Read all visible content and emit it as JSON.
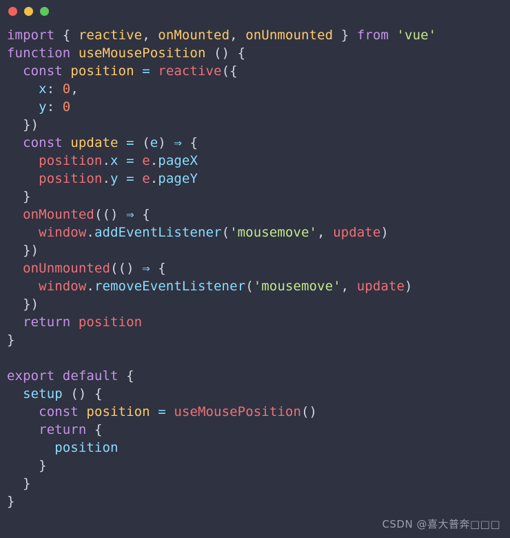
{
  "window": {
    "title_bar": {
      "buttons": [
        {
          "name": "close",
          "label": "",
          "color": "#f0635b"
        },
        {
          "name": "minimize",
          "label": "",
          "color": "#f0c04b"
        },
        {
          "name": "maximize",
          "label": "",
          "color": "#5bc85b"
        }
      ]
    },
    "background_color": "#2f3240"
  },
  "watermark": {
    "text": "CSDN @喜大普奔□□□"
  },
  "editor": {
    "language": "javascript",
    "font_size_px": 19,
    "line_height_px": 26,
    "theme": {
      "background": "#2f3240",
      "keyword": "#c792ea",
      "function": "#ffcb6b",
      "variable": "#f07178",
      "property": "#89ddff",
      "string": "#c3e88d",
      "number": "#f78c6c",
      "punctuation": "#d5d8e0",
      "operator": "#89ddff"
    },
    "code_text": "import { reactive, onMounted, onUnmounted } from 'vue'\nfunction useMousePosition () {\n  const position = reactive({\n    x: 0,\n    y: 0\n  })\n  const update = (e) => {\n    position.x = e.pageX\n    position.y = e.pageY\n  }\n  onMounted(() => {\n    window.addEventListener('mousemove', update)\n  })\n  onUnmounted(() => {\n    window.removeEventListener('mousemove', update)\n  })\n  return position\n}\n\nexport default {\n  setup () {\n    const position = useMousePosition()\n    return {\n      position\n    }\n  }\n}",
    "lines": [
      {
        "n": 1,
        "tokens": [
          {
            "t": "import",
            "c": "kw"
          },
          {
            "t": " ",
            "c": "plain"
          },
          {
            "t": "{",
            "c": "punc"
          },
          {
            "t": " ",
            "c": "plain"
          },
          {
            "t": "reactive",
            "c": "fn"
          },
          {
            "t": ",",
            "c": "punc"
          },
          {
            "t": " ",
            "c": "plain"
          },
          {
            "t": "onMounted",
            "c": "fn"
          },
          {
            "t": ",",
            "c": "punc"
          },
          {
            "t": " ",
            "c": "plain"
          },
          {
            "t": "onUnmounted",
            "c": "fn"
          },
          {
            "t": " ",
            "c": "plain"
          },
          {
            "t": "}",
            "c": "punc"
          },
          {
            "t": " ",
            "c": "plain"
          },
          {
            "t": "from",
            "c": "kw"
          },
          {
            "t": " ",
            "c": "plain"
          },
          {
            "t": "'vue'",
            "c": "str"
          }
        ]
      },
      {
        "n": 2,
        "tokens": [
          {
            "t": "function",
            "c": "kw"
          },
          {
            "t": " ",
            "c": "plain"
          },
          {
            "t": "useMousePosition",
            "c": "fn"
          },
          {
            "t": " ",
            "c": "plain"
          },
          {
            "t": "()",
            "c": "punc"
          },
          {
            "t": " ",
            "c": "plain"
          },
          {
            "t": "{",
            "c": "punc"
          }
        ]
      },
      {
        "n": 3,
        "tokens": [
          {
            "t": "  ",
            "c": "plain"
          },
          {
            "t": "const",
            "c": "kw"
          },
          {
            "t": " ",
            "c": "plain"
          },
          {
            "t": "position",
            "c": "fn"
          },
          {
            "t": " ",
            "c": "plain"
          },
          {
            "t": "=",
            "c": "op"
          },
          {
            "t": " ",
            "c": "plain"
          },
          {
            "t": "reactive",
            "c": "var"
          },
          {
            "t": "(",
            "c": "punc"
          },
          {
            "t": "{",
            "c": "punc"
          }
        ]
      },
      {
        "n": 4,
        "tokens": [
          {
            "t": "    ",
            "c": "plain"
          },
          {
            "t": "x",
            "c": "prop"
          },
          {
            "t": ":",
            "c": "punc"
          },
          {
            "t": " ",
            "c": "plain"
          },
          {
            "t": "0",
            "c": "num"
          },
          {
            "t": ",",
            "c": "punc"
          }
        ]
      },
      {
        "n": 5,
        "tokens": [
          {
            "t": "    ",
            "c": "plain"
          },
          {
            "t": "y",
            "c": "prop"
          },
          {
            "t": ":",
            "c": "punc"
          },
          {
            "t": " ",
            "c": "plain"
          },
          {
            "t": "0",
            "c": "num"
          }
        ]
      },
      {
        "n": 6,
        "tokens": [
          {
            "t": "  ",
            "c": "plain"
          },
          {
            "t": "})",
            "c": "punc"
          }
        ]
      },
      {
        "n": 7,
        "tokens": [
          {
            "t": "  ",
            "c": "plain"
          },
          {
            "t": "const",
            "c": "kw"
          },
          {
            "t": " ",
            "c": "plain"
          },
          {
            "t": "update",
            "c": "fn"
          },
          {
            "t": " ",
            "c": "plain"
          },
          {
            "t": "=",
            "c": "op"
          },
          {
            "t": " ",
            "c": "plain"
          },
          {
            "t": "(",
            "c": "punc"
          },
          {
            "t": "e",
            "c": "prop"
          },
          {
            "t": ")",
            "c": "punc"
          },
          {
            "t": " ",
            "c": "plain"
          },
          {
            "t": "⇒",
            "c": "op"
          },
          {
            "t": " ",
            "c": "plain"
          },
          {
            "t": "{",
            "c": "punc"
          }
        ]
      },
      {
        "n": 8,
        "tokens": [
          {
            "t": "    ",
            "c": "plain"
          },
          {
            "t": "position",
            "c": "var"
          },
          {
            "t": ".",
            "c": "punc"
          },
          {
            "t": "x",
            "c": "prop"
          },
          {
            "t": " ",
            "c": "plain"
          },
          {
            "t": "=",
            "c": "op"
          },
          {
            "t": " ",
            "c": "plain"
          },
          {
            "t": "e",
            "c": "var"
          },
          {
            "t": ".",
            "c": "punc"
          },
          {
            "t": "pageX",
            "c": "prop"
          }
        ]
      },
      {
        "n": 9,
        "tokens": [
          {
            "t": "    ",
            "c": "plain"
          },
          {
            "t": "position",
            "c": "var"
          },
          {
            "t": ".",
            "c": "punc"
          },
          {
            "t": "y",
            "c": "prop"
          },
          {
            "t": " ",
            "c": "plain"
          },
          {
            "t": "=",
            "c": "op"
          },
          {
            "t": " ",
            "c": "plain"
          },
          {
            "t": "e",
            "c": "var"
          },
          {
            "t": ".",
            "c": "punc"
          },
          {
            "t": "pageY",
            "c": "prop"
          }
        ]
      },
      {
        "n": 10,
        "tokens": [
          {
            "t": "  ",
            "c": "plain"
          },
          {
            "t": "}",
            "c": "punc"
          }
        ]
      },
      {
        "n": 11,
        "tokens": [
          {
            "t": "  ",
            "c": "plain"
          },
          {
            "t": "onMounted",
            "c": "var"
          },
          {
            "t": "((",
            "c": "punc"
          },
          {
            "t": ")",
            "c": "punc"
          },
          {
            "t": " ",
            "c": "plain"
          },
          {
            "t": "⇒",
            "c": "op"
          },
          {
            "t": " ",
            "c": "plain"
          },
          {
            "t": "{",
            "c": "punc"
          }
        ]
      },
      {
        "n": 12,
        "tokens": [
          {
            "t": "    ",
            "c": "plain"
          },
          {
            "t": "window",
            "c": "var"
          },
          {
            "t": ".",
            "c": "punc"
          },
          {
            "t": "addEventListener",
            "c": "prop"
          },
          {
            "t": "(",
            "c": "punc"
          },
          {
            "t": "'mousemove'",
            "c": "str"
          },
          {
            "t": ",",
            "c": "punc"
          },
          {
            "t": " ",
            "c": "plain"
          },
          {
            "t": "update",
            "c": "var"
          },
          {
            "t": ")",
            "c": "punc"
          }
        ]
      },
      {
        "n": 13,
        "tokens": [
          {
            "t": "  ",
            "c": "plain"
          },
          {
            "t": "})",
            "c": "punc"
          }
        ]
      },
      {
        "n": 14,
        "tokens": [
          {
            "t": "  ",
            "c": "plain"
          },
          {
            "t": "onUnmounted",
            "c": "var"
          },
          {
            "t": "((",
            "c": "punc"
          },
          {
            "t": ")",
            "c": "punc"
          },
          {
            "t": " ",
            "c": "plain"
          },
          {
            "t": "⇒",
            "c": "op"
          },
          {
            "t": " ",
            "c": "plain"
          },
          {
            "t": "{",
            "c": "punc"
          }
        ]
      },
      {
        "n": 15,
        "tokens": [
          {
            "t": "    ",
            "c": "plain"
          },
          {
            "t": "window",
            "c": "var"
          },
          {
            "t": ".",
            "c": "punc"
          },
          {
            "t": "removeEventListener",
            "c": "prop"
          },
          {
            "t": "(",
            "c": "punc"
          },
          {
            "t": "'mousemove'",
            "c": "str"
          },
          {
            "t": ",",
            "c": "punc"
          },
          {
            "t": " ",
            "c": "plain"
          },
          {
            "t": "update",
            "c": "var"
          },
          {
            "t": ")",
            "c": "punc"
          }
        ]
      },
      {
        "n": 16,
        "tokens": [
          {
            "t": "  ",
            "c": "plain"
          },
          {
            "t": "})",
            "c": "punc"
          }
        ]
      },
      {
        "n": 17,
        "tokens": [
          {
            "t": "  ",
            "c": "plain"
          },
          {
            "t": "return",
            "c": "kw"
          },
          {
            "t": " ",
            "c": "plain"
          },
          {
            "t": "position",
            "c": "var"
          }
        ]
      },
      {
        "n": 18,
        "tokens": [
          {
            "t": "}",
            "c": "punc"
          }
        ]
      },
      {
        "n": 19,
        "tokens": []
      },
      {
        "n": 20,
        "tokens": [
          {
            "t": "export",
            "c": "kw"
          },
          {
            "t": " ",
            "c": "plain"
          },
          {
            "t": "default",
            "c": "kw"
          },
          {
            "t": " ",
            "c": "plain"
          },
          {
            "t": "{",
            "c": "punc"
          }
        ]
      },
      {
        "n": 21,
        "tokens": [
          {
            "t": "  ",
            "c": "plain"
          },
          {
            "t": "setup",
            "c": "prop"
          },
          {
            "t": " ",
            "c": "plain"
          },
          {
            "t": "()",
            "c": "punc"
          },
          {
            "t": " ",
            "c": "plain"
          },
          {
            "t": "{",
            "c": "punc"
          }
        ]
      },
      {
        "n": 22,
        "tokens": [
          {
            "t": "    ",
            "c": "plain"
          },
          {
            "t": "const",
            "c": "kw"
          },
          {
            "t": " ",
            "c": "plain"
          },
          {
            "t": "position",
            "c": "fn"
          },
          {
            "t": " ",
            "c": "plain"
          },
          {
            "t": "=",
            "c": "op"
          },
          {
            "t": " ",
            "c": "plain"
          },
          {
            "t": "useMousePosition",
            "c": "var"
          },
          {
            "t": "()",
            "c": "punc"
          }
        ]
      },
      {
        "n": 23,
        "tokens": [
          {
            "t": "    ",
            "c": "plain"
          },
          {
            "t": "return",
            "c": "kw"
          },
          {
            "t": " ",
            "c": "plain"
          },
          {
            "t": "{",
            "c": "punc"
          }
        ]
      },
      {
        "n": 24,
        "tokens": [
          {
            "t": "      ",
            "c": "plain"
          },
          {
            "t": "position",
            "c": "prop"
          }
        ]
      },
      {
        "n": 25,
        "tokens": [
          {
            "t": "    ",
            "c": "plain"
          },
          {
            "t": "}",
            "c": "punc"
          }
        ]
      },
      {
        "n": 26,
        "tokens": [
          {
            "t": "  ",
            "c": "plain"
          },
          {
            "t": "}",
            "c": "punc"
          }
        ]
      },
      {
        "n": 27,
        "tokens": [
          {
            "t": "}",
            "c": "punc"
          }
        ]
      }
    ]
  }
}
